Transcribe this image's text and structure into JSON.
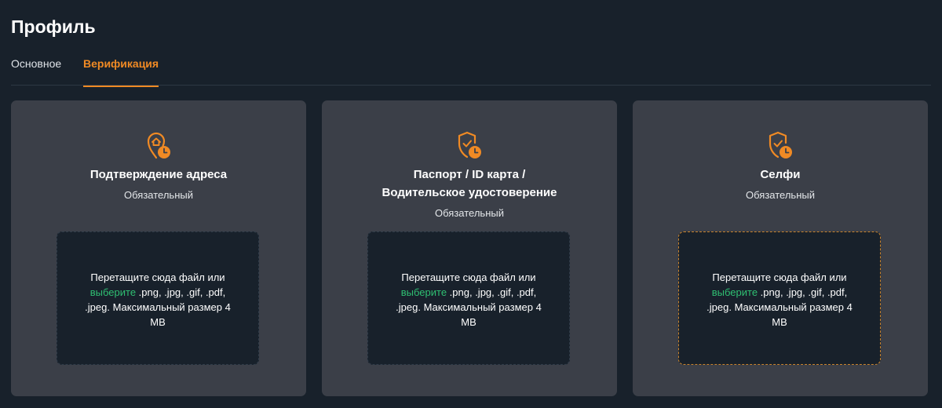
{
  "page": {
    "title": "Профиль"
  },
  "tabs": [
    {
      "label": "Основное",
      "active": false
    },
    {
      "label": "Верификация",
      "active": true
    }
  ],
  "colors": {
    "background": "#18212b",
    "card": "#3b3f48",
    "accent": "#f08a24",
    "link": "#2fbf72"
  },
  "cards": [
    {
      "icon": "location-clock-icon",
      "title": "Подтверждение адреса",
      "subtitle": "Обязательный",
      "dropzone": {
        "text_before": "Перетащите сюда файл или",
        "link": "выберите",
        "text_after": ".png, .jpg, .gif, .pdf, .jpeg. Максимальный размер 4 MB"
      }
    },
    {
      "icon": "shield-check-clock-icon",
      "title_line1": "Паспорт / ID карта /",
      "title_line2": "Водительское удостоверение",
      "subtitle": "Обязательный",
      "dropzone": {
        "text_before": "Перетащите сюда файл или",
        "link": "выберите",
        "text_after": ".png, .jpg, .gif, .pdf, .jpeg. Максимальный размер 4 MB"
      }
    },
    {
      "icon": "shield-check-clock-icon",
      "title": "Селфи",
      "subtitle": "Обязательный",
      "dropzone": {
        "text_before": "Перетащите сюда файл или",
        "link": "выберите",
        "text_after": ".png, .jpg, .gif, .pdf, .jpeg. Максимальный размер 4 MB"
      }
    }
  ]
}
